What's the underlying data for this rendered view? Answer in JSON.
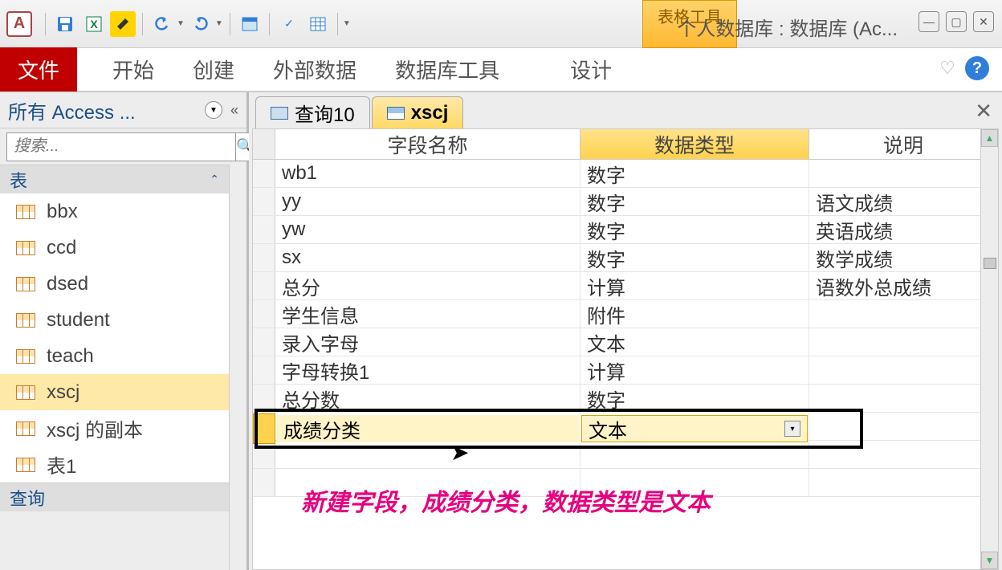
{
  "titlebar": {
    "appLetter": "A",
    "contextualTab": "表格工具",
    "title": "个人数据库 : 数据库 (Ac..."
  },
  "ribbon": {
    "fileTab": "文件",
    "tabs": [
      "开始",
      "创建",
      "外部数据",
      "数据库工具",
      "设计"
    ]
  },
  "navPane": {
    "title": "所有 Access ...",
    "searchPlaceholder": "搜索...",
    "group1": "表",
    "tables": [
      "bbx",
      "ccd",
      "dsed",
      "student",
      "teach",
      "xscj",
      "xscj 的副本",
      "表1"
    ],
    "group2": "查询"
  },
  "docTabs": {
    "tab1": "查询10",
    "tab2": "xscj"
  },
  "gridHeaders": {
    "field": "字段名称",
    "type": "数据类型",
    "desc": "说明"
  },
  "rows": [
    {
      "field": "wb1",
      "type": "数字",
      "desc": ""
    },
    {
      "field": "yy",
      "type": "数字",
      "desc": "语文成绩"
    },
    {
      "field": "yw",
      "type": "数字",
      "desc": "英语成绩"
    },
    {
      "field": "sx",
      "type": "数字",
      "desc": "数学成绩"
    },
    {
      "field": "总分",
      "type": "计算",
      "desc": "语数外总成绩"
    },
    {
      "field": "学生信息",
      "type": "附件",
      "desc": ""
    },
    {
      "field": "录入字母",
      "type": "文本",
      "desc": ""
    },
    {
      "field": "字母转换1",
      "type": "计算",
      "desc": ""
    },
    {
      "field": "总分数",
      "type": "数字",
      "desc": ""
    }
  ],
  "activeRow": {
    "field": "成绩分类",
    "type": "文本"
  },
  "annotation": "新建字段，成绩分类，数据类型是文本"
}
